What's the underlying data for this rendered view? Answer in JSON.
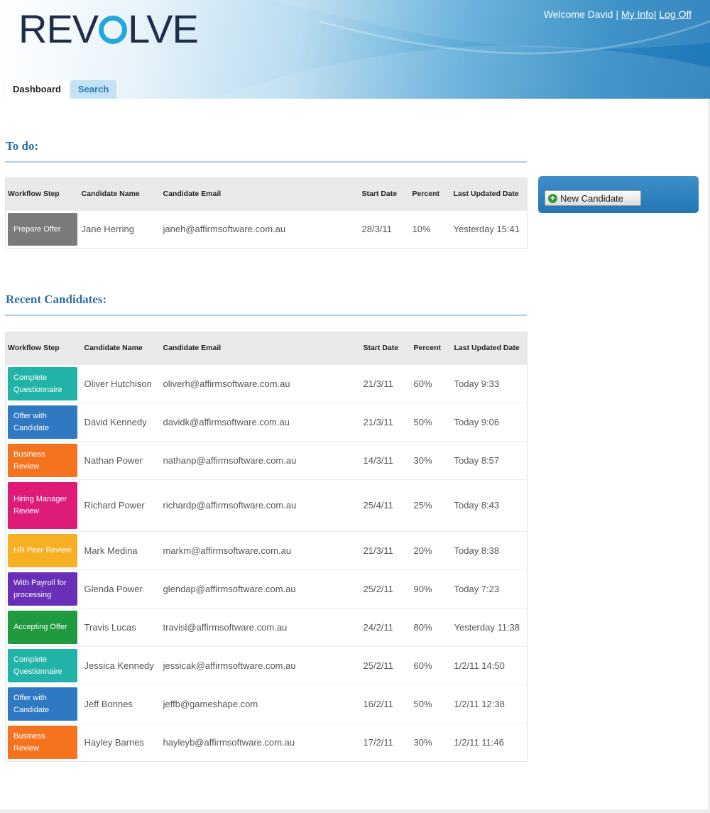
{
  "header": {
    "logo_text": [
      "REV",
      "LVE"
    ],
    "welcome": "Welcome David",
    "my_info": "My Info",
    "log_off": "Log Off"
  },
  "tabs": [
    {
      "label": "Dashboard",
      "active": true
    },
    {
      "label": "Search",
      "active": false
    }
  ],
  "todo": {
    "title": "To do:",
    "columns": [
      "Workflow Step",
      "Candidate Name",
      "Candidate Email",
      "Start Date",
      "Percent",
      "Last Updated Date"
    ],
    "rows": [
      {
        "step": "Prepare Offer",
        "color": "#7a7a7a",
        "name": "Jane Herring",
        "email": "janeh@affirmsoftware.com.au",
        "start": "28/3/11",
        "percent": "10%",
        "updated": "Yesterday 15:41"
      }
    ]
  },
  "recent": {
    "title": "Recent Candidates:",
    "columns": [
      "Workflow Step",
      "Candidate Name",
      "Candidate Email",
      "Start Date",
      "Percent",
      "Last Updated Date"
    ],
    "rows": [
      {
        "step": "Complete Questionnaire",
        "color": "#22b3a8",
        "name": "Oliver Hutchison",
        "email": "oliverh@affirmsoftware.com.au",
        "start": "21/3/11",
        "percent": "60%",
        "updated": "Today 9:33"
      },
      {
        "step": "Offer with Candidate",
        "color": "#2f78c2",
        "name": "David Kennedy",
        "email": "davidk@affirmsoftware.com.au",
        "start": "21/3/11",
        "percent": "50%",
        "updated": "Today 9:06"
      },
      {
        "step": "Business Review",
        "color": "#f5731f",
        "name": "Nathan Power",
        "email": "nathanp@affirmsoftware.com.au",
        "start": "14/3/11",
        "percent": "30%",
        "updated": "Today 8:57"
      },
      {
        "step": "Hiring Manager Review",
        "color": "#de1c78",
        "name": "Richard Power",
        "email": "richardp@affirmsoftware.com.au",
        "start": "25/4/11",
        "percent": "25%",
        "updated": "Today 8:43"
      },
      {
        "step": "HR Peer Review",
        "color": "#f7b024",
        "name": "Mark Medina",
        "email": "markm@affirmsoftware.com.au",
        "start": "21/3/11",
        "percent": "20%",
        "updated": "Today 8:38"
      },
      {
        "step": "With Payroll for processing",
        "color": "#6a2fb8",
        "name": "Glenda Power",
        "email": "glendap@affirmsoftware.com.au",
        "start": "25/2/11",
        "percent": "90%",
        "updated": "Today 7:23"
      },
      {
        "step": "Accepting Offer",
        "color": "#1f9a3e",
        "name": "Travis Lucas",
        "email": "travisl@affirmsoftware.com.au",
        "start": "24/2/11",
        "percent": "80%",
        "updated": "Yesterday 11:38"
      },
      {
        "step": "Complete Questionnaire",
        "color": "#22b3a8",
        "name": "Jessica Kennedy",
        "email": "jessicak@affirmsoftware.com.au",
        "start": "25/2/11",
        "percent": "60%",
        "updated": "1/2/11 14:50"
      },
      {
        "step": "Offer with Candidate",
        "color": "#2f78c2",
        "name": "Jeff Bonnes",
        "email": "jeffb@gameshape.com",
        "start": "16/2/11",
        "percent": "50%",
        "updated": "1/2/11 12:38"
      },
      {
        "step": "Business Review",
        "color": "#f5731f",
        "name": "Hayley Barnes",
        "email": "hayleyb@affirmsoftware.com.au",
        "start": "17/2/11",
        "percent": "30%",
        "updated": "1/2/11 11:46"
      }
    ]
  },
  "panel": {
    "new_candidate": "New Candidate"
  },
  "icons": {
    "plus": "plus-circle-icon"
  }
}
